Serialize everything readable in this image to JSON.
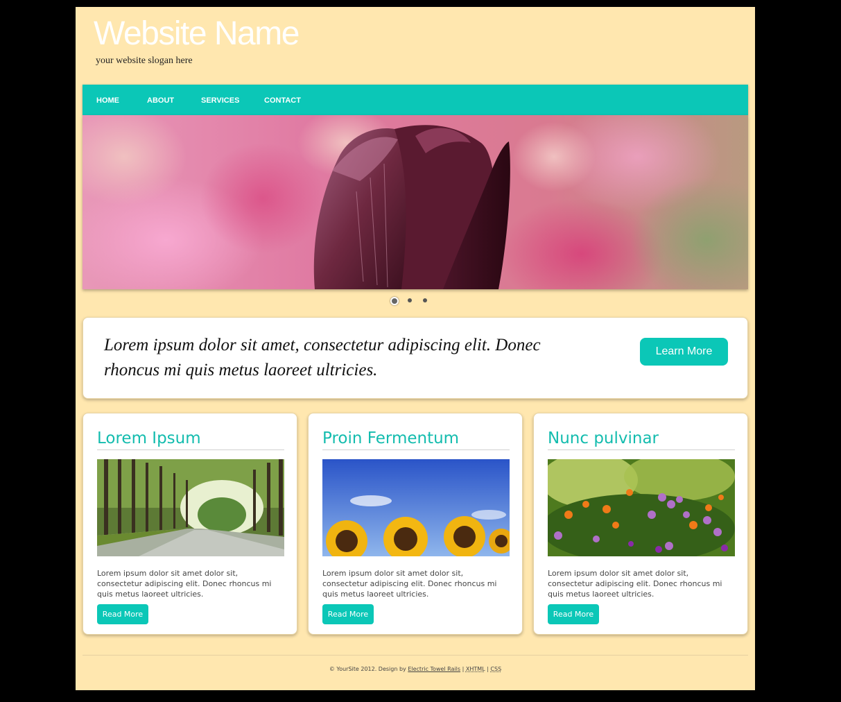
{
  "header": {
    "site_name": "Website Name",
    "slogan": "your website slogan here"
  },
  "nav": {
    "items": [
      {
        "label": "HOME"
      },
      {
        "label": "ABOUT"
      },
      {
        "label": "SERVICES"
      },
      {
        "label": "CONTACT"
      }
    ]
  },
  "slider": {
    "slide_count": 3,
    "active_index": 0,
    "image": "tulip-photo"
  },
  "callout": {
    "text": "Lorem ipsum dolor sit amet, consectetur adipiscing elit. Donec rhoncus mi quis metus laoreet ultricies.",
    "button_label": "Learn More"
  },
  "cards": [
    {
      "title": "Lorem Ipsum",
      "image": "tree-lined-road-photo",
      "text": "Lorem ipsum dolor sit amet dolor sit, consectetur adipiscing elit. Donec rhoncus mi quis metus laoreet ultricies.",
      "button_label": "Read More"
    },
    {
      "title": "Proin Fermentum",
      "image": "sunflowers-photo",
      "text": "Lorem ipsum dolor sit amet dolor sit, consectetur adipiscing elit. Donec rhoncus mi quis metus laoreet ultricies.",
      "button_label": "Read More"
    },
    {
      "title": "Nunc pulvinar",
      "image": "wildflowers-photo",
      "text": "Lorem ipsum dolor sit amet dolor sit, consectetur adipiscing elit. Donec rhoncus mi quis metus laoreet ultricies.",
      "button_label": "Read More"
    }
  ],
  "footer": {
    "copyright": "© YourSite 2012.  Design by",
    "designer_link": "Electric Towel Rails",
    "separator": "|",
    "xhtml_link": "XHTML",
    "css_link": "CSS"
  },
  "colors": {
    "page_background": "#ffe7af",
    "outer_background": "#000000",
    "accent": "#0bc7b7",
    "card_title": "#13bcae"
  }
}
